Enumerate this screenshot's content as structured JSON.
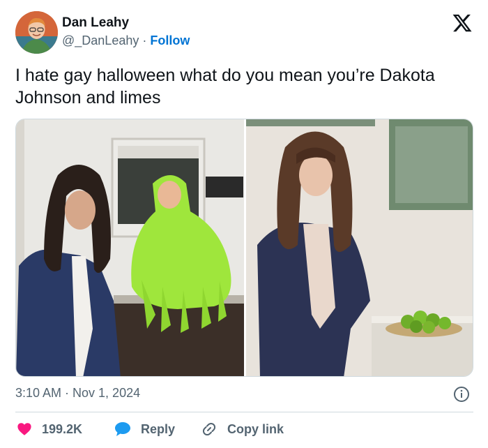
{
  "author": {
    "name": "Dan Leahy",
    "handle": "@_DanLeahy",
    "separator": "·",
    "follow_label": "Follow"
  },
  "brand_icon": "x-logo-icon",
  "tweet": {
    "text": "I hate gay halloween what do you mean you’re Dakota Johnson and limes"
  },
  "media": {
    "photos": [
      "left-photo",
      "right-photo"
    ]
  },
  "meta": {
    "timestamp": "3:10 AM · Nov 1, 2024",
    "info_icon": "info-icon"
  },
  "actions": {
    "like_count": "199.2K",
    "reply_label": "Reply",
    "copy_link_label": "Copy link"
  },
  "colors": {
    "accent": "#0074d4",
    "like": "#f91880",
    "reply": "#1d9bf0",
    "text": "#0f1419",
    "muted": "#536471"
  }
}
